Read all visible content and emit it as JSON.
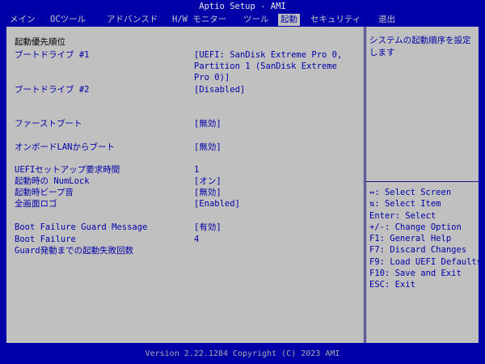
{
  "title": "Aptio Setup - AMI",
  "tabs": [
    "メイン",
    "OCツール",
    "アドバンスド",
    "H/W モニター",
    "ツール",
    "起動",
    "セキュリティ",
    "退出"
  ],
  "active_tab": "起動",
  "section_title": "起動優先順位",
  "settings": {
    "boot_drive_1": {
      "label": "ブートドライブ #1",
      "value": [
        "[UEFI: SanDisk Extreme Pro 0,",
        "Partition 1 (SanDisk Extreme",
        "Pro 0)]"
      ]
    },
    "boot_drive_2": {
      "label": "ブートドライブ #2",
      "value": "[Disabled]"
    },
    "fast_boot": {
      "label": "ファーストブート",
      "value": "[無効]"
    },
    "onboard_lan_boot": {
      "label": "オンボードLANからブート",
      "value": "[無効]"
    },
    "uefi_setup_wait": {
      "label": "UEFIセットアップ要求時間",
      "value": "1"
    },
    "numlock": {
      "label": "起動時の NumLock",
      "value": "[オン]"
    },
    "boot_beep": {
      "label": "起動時ビープ音",
      "value": "[無効]"
    },
    "fullscreen_logo": {
      "label": "全画面ロゴ",
      "value": "[Enabled]"
    },
    "bfg_message": {
      "label": "Boot Failure Guard Message",
      "value": "[有効]"
    },
    "bfg_count": {
      "label": "Boot Failure",
      "label2": "Guard発動までの起動失敗回数",
      "value": "4"
    }
  },
  "help_text": "システムの起動順序を設定します",
  "keys": [
    "↔: Select Screen",
    "⇅: Select Item",
    "Enter: Select",
    "+/-: Change Option",
    "F1: General Help",
    "F7: Discard Changes",
    "F9: Load UEFI Defaults",
    "F10: Save and Exit",
    "ESC: Exit"
  ],
  "footer": "Version 2.22.1284 Copyright (C) 2023 AMI",
  "colors": {
    "background": "#0000a8",
    "panel": "#c0c0c0",
    "text": "#0000a8"
  }
}
